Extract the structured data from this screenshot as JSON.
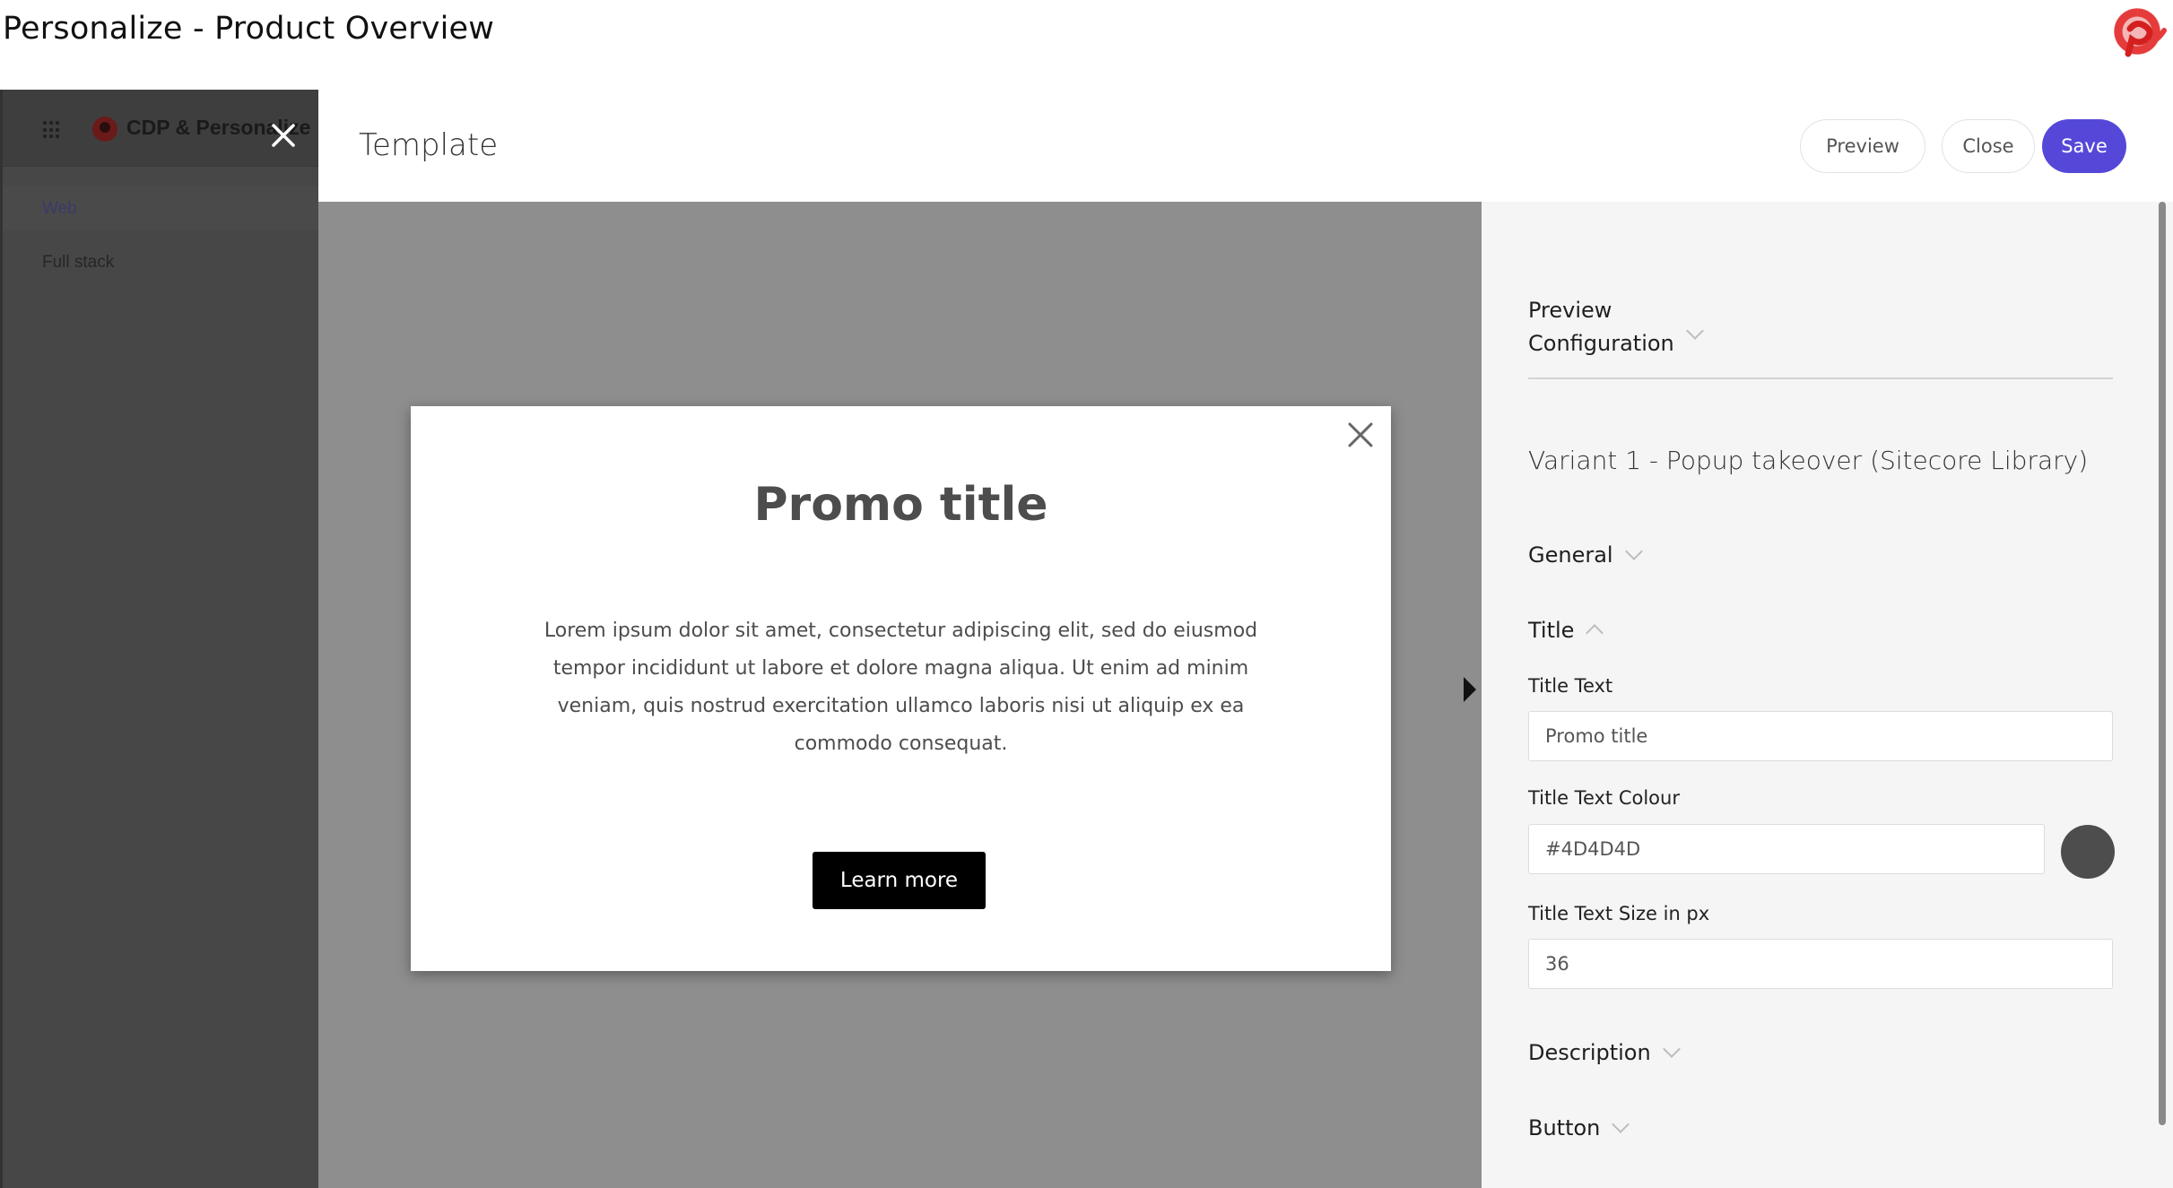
{
  "page": {
    "title": "Personalize - Product Overview"
  },
  "sidebar": {
    "product_name": "CDP & Personalize",
    "items": [
      {
        "label": "Web"
      },
      {
        "label": "Full stack"
      }
    ]
  },
  "header": {
    "title": "Template",
    "preview_label": "Preview",
    "close_label": "Close",
    "save_label": "Save"
  },
  "popup": {
    "title": "Promo title",
    "body": "Lorem ipsum dolor sit amet, consectetur adipiscing elit, sed do eiusmod tempor incididunt ut labore et dolore magna aliqua. Ut enim ad minim veniam, quis nostrud exercitation ullamco laboris nisi ut aliquip ex ea commodo consequat.",
    "button_label": "Learn more"
  },
  "panel": {
    "preview_config_line1": "Preview",
    "preview_config_line2": "Configuration",
    "variant_name": "Variant 1 - Popup takeover (Sitecore Library)",
    "sections": {
      "general": "General",
      "title": "Title",
      "description": "Description",
      "button": "Button"
    },
    "fields": {
      "title_text_label": "Title Text",
      "title_text_value": "Promo title",
      "title_colour_label": "Title Text Colour",
      "title_colour_value": "#4D4D4D",
      "title_size_label": "Title Text Size in px",
      "title_size_value": "36"
    }
  },
  "colors": {
    "accent": "#5548d9",
    "title_text": "#4D4D4D",
    "brand": "#e02b2b"
  }
}
